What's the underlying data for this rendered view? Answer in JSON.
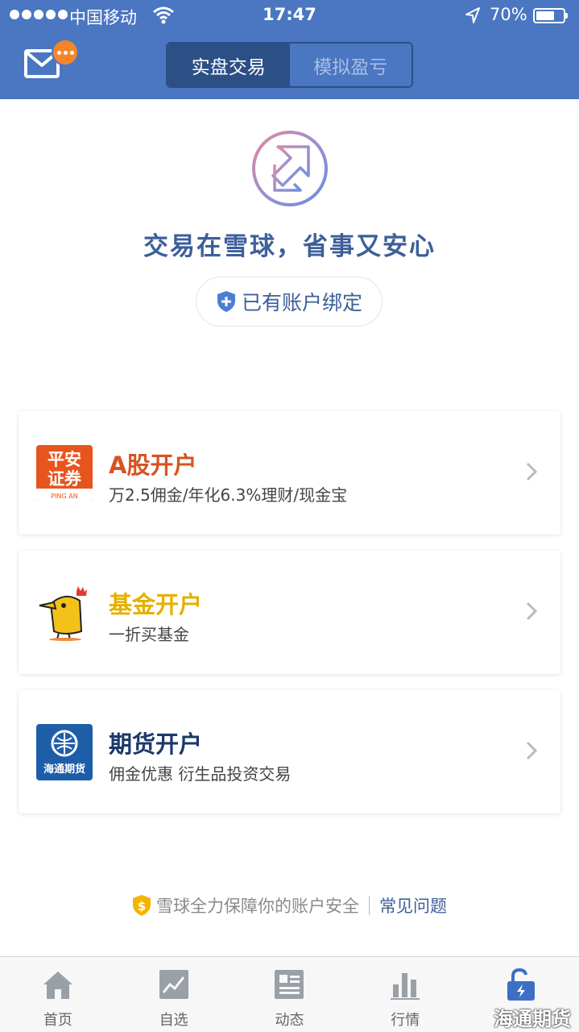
{
  "status_bar": {
    "carrier": "中国移动",
    "time": "17:47",
    "battery": "70%",
    "battery_level": 0.7
  },
  "header": {
    "mail_badge_icon": "ellipsis-icon",
    "segments": [
      {
        "label": "实盘交易",
        "active": true
      },
      {
        "label": "模拟盈亏",
        "active": false
      }
    ]
  },
  "hero": {
    "slogan": "交易在雪球，省事又安心",
    "bind_button": "已有账户绑定"
  },
  "cards": [
    {
      "title": "A股开户",
      "subtitle": "万2.5佣金/年化6.3%理财/现金宝",
      "title_color": "#d9531e",
      "logo_lines": [
        "平安",
        "证券"
      ],
      "logo_caption": "PING AN"
    },
    {
      "title": "基金开户",
      "subtitle": "一折买基金",
      "title_color": "#e5b000"
    },
    {
      "title": "期货开户",
      "subtitle": "佣金优惠 衍生品投资交易",
      "title_color": "#1a3a6b",
      "logo_caption": "海通期货"
    }
  ],
  "footer_note": {
    "text": "雪球全力保障你的账户安全",
    "link": "常见问题"
  },
  "tabbar": [
    {
      "label": "首页",
      "icon": "home-icon"
    },
    {
      "label": "自选",
      "icon": "chart-icon"
    },
    {
      "label": "动态",
      "icon": "feed-icon"
    },
    {
      "label": "行情",
      "icon": "bars-icon"
    },
    {
      "label": "",
      "icon": "unlock-icon",
      "active": true
    }
  ],
  "watermark": "海通期货",
  "colors": {
    "header_blue": "#4a76c2",
    "segment_dark": "#2c4f86",
    "text_blue": "#3d5f9a"
  }
}
